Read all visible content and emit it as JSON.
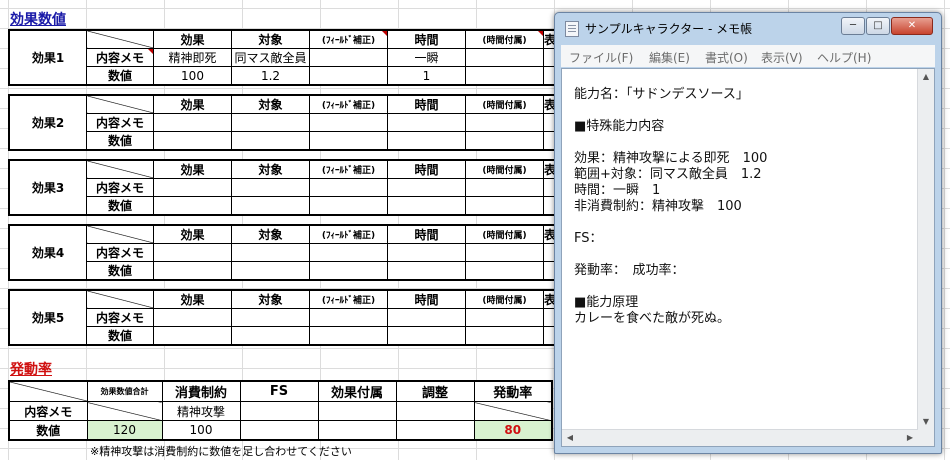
{
  "spreadsheet": {
    "section1_title": "効果数値",
    "section2_title": "発動率",
    "headers": {
      "effect": "効果",
      "target": "対象",
      "field": "(ﾌｨｰﾙﾄﾞ補正)",
      "time": "時間",
      "time_attr": "(時間付属)",
      "extra": "表"
    },
    "row_labels": {
      "memo": "内容メモ",
      "value": "数値"
    },
    "effects": [
      {
        "name": "効果1",
        "memo": [
          "精神即死",
          "同マス敵全員",
          "",
          "一瞬",
          ""
        ],
        "values": [
          "100",
          "1.2",
          "",
          "1",
          ""
        ]
      },
      {
        "name": "効果2",
        "memo": [
          "",
          "",
          "",
          "",
          ""
        ],
        "values": [
          "",
          "",
          "",
          "",
          ""
        ]
      },
      {
        "name": "効果3",
        "memo": [
          "",
          "",
          "",
          "",
          ""
        ],
        "values": [
          "",
          "",
          "",
          "",
          ""
        ]
      },
      {
        "name": "効果4",
        "memo": [
          "",
          "",
          "",
          "",
          ""
        ],
        "values": [
          "",
          "",
          "",
          "",
          ""
        ]
      },
      {
        "name": "効果5",
        "memo": [
          "",
          "",
          "",
          "",
          ""
        ],
        "values": [
          "",
          "",
          "",
          "",
          ""
        ]
      }
    ],
    "rate": {
      "headers": [
        "効果数値合計",
        "消費制約",
        "FS",
        "効果付属",
        "調整",
        "発動率"
      ],
      "memo": [
        "",
        "精神攻撃",
        "",
        "",
        "",
        ""
      ],
      "values": [
        "120",
        "100",
        "",
        "",
        "",
        "80"
      ]
    },
    "note": "※精神攻撃は消費制約に数値を足し合わせてください"
  },
  "notepad": {
    "title": "サンプルキャラクター - メモ帳",
    "menu": [
      "ファイル(F)",
      "編集(E)",
      "書式(O)",
      "表示(V)",
      "ヘルプ(H)"
    ],
    "lines": [
      "能力名：「サドンデスソース」",
      "",
      "■特殊能力内容",
      "",
      "効果：精神攻撃による即死　100",
      "範囲+対象：同マス敵全員　1.2",
      "時間：一瞬　1",
      "非消費制約：精神攻撃　100",
      "",
      "FS：",
      "",
      "発動率：　成功率：",
      "",
      "■能力原理",
      "カレーを食べた敵が死ぬ。"
    ]
  }
}
